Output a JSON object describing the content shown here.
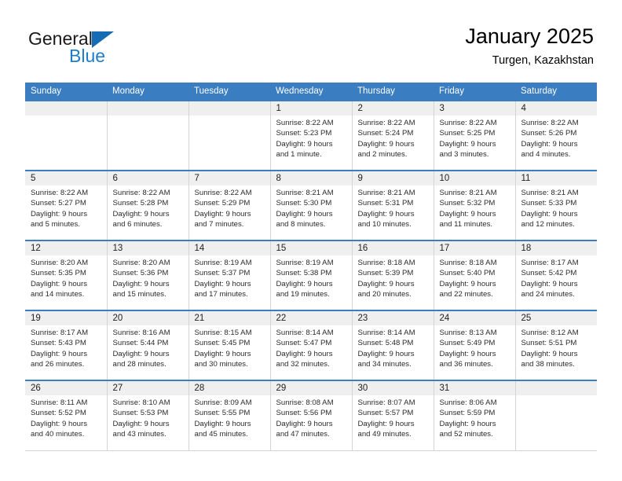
{
  "brand": {
    "name_top": "General",
    "name_bottom": "Blue",
    "triangle_color": "#156cb4",
    "blue_color": "#1f7cc6"
  },
  "header": {
    "title": "January 2025",
    "subtitle": "Turgen, Kazakhstan"
  },
  "theme": {
    "header_bg": "#3a7dc0",
    "daynum_bg": "#efefef",
    "grid_border": "#d4d4d4",
    "row_top_border": "#3a7dc0"
  },
  "weekdays": [
    "Sunday",
    "Monday",
    "Tuesday",
    "Wednesday",
    "Thursday",
    "Friday",
    "Saturday"
  ],
  "weeks": [
    [
      {
        "day": "",
        "lines": []
      },
      {
        "day": "",
        "lines": []
      },
      {
        "day": "",
        "lines": []
      },
      {
        "day": "1",
        "lines": [
          "Sunrise: 8:22 AM",
          "Sunset: 5:23 PM",
          "Daylight: 9 hours",
          "and 1 minute."
        ]
      },
      {
        "day": "2",
        "lines": [
          "Sunrise: 8:22 AM",
          "Sunset: 5:24 PM",
          "Daylight: 9 hours",
          "and 2 minutes."
        ]
      },
      {
        "day": "3",
        "lines": [
          "Sunrise: 8:22 AM",
          "Sunset: 5:25 PM",
          "Daylight: 9 hours",
          "and 3 minutes."
        ]
      },
      {
        "day": "4",
        "lines": [
          "Sunrise: 8:22 AM",
          "Sunset: 5:26 PM",
          "Daylight: 9 hours",
          "and 4 minutes."
        ]
      }
    ],
    [
      {
        "day": "5",
        "lines": [
          "Sunrise: 8:22 AM",
          "Sunset: 5:27 PM",
          "Daylight: 9 hours",
          "and 5 minutes."
        ]
      },
      {
        "day": "6",
        "lines": [
          "Sunrise: 8:22 AM",
          "Sunset: 5:28 PM",
          "Daylight: 9 hours",
          "and 6 minutes."
        ]
      },
      {
        "day": "7",
        "lines": [
          "Sunrise: 8:22 AM",
          "Sunset: 5:29 PM",
          "Daylight: 9 hours",
          "and 7 minutes."
        ]
      },
      {
        "day": "8",
        "lines": [
          "Sunrise: 8:21 AM",
          "Sunset: 5:30 PM",
          "Daylight: 9 hours",
          "and 8 minutes."
        ]
      },
      {
        "day": "9",
        "lines": [
          "Sunrise: 8:21 AM",
          "Sunset: 5:31 PM",
          "Daylight: 9 hours",
          "and 10 minutes."
        ]
      },
      {
        "day": "10",
        "lines": [
          "Sunrise: 8:21 AM",
          "Sunset: 5:32 PM",
          "Daylight: 9 hours",
          "and 11 minutes."
        ]
      },
      {
        "day": "11",
        "lines": [
          "Sunrise: 8:21 AM",
          "Sunset: 5:33 PM",
          "Daylight: 9 hours",
          "and 12 minutes."
        ]
      }
    ],
    [
      {
        "day": "12",
        "lines": [
          "Sunrise: 8:20 AM",
          "Sunset: 5:35 PM",
          "Daylight: 9 hours",
          "and 14 minutes."
        ]
      },
      {
        "day": "13",
        "lines": [
          "Sunrise: 8:20 AM",
          "Sunset: 5:36 PM",
          "Daylight: 9 hours",
          "and 15 minutes."
        ]
      },
      {
        "day": "14",
        "lines": [
          "Sunrise: 8:19 AM",
          "Sunset: 5:37 PM",
          "Daylight: 9 hours",
          "and 17 minutes."
        ]
      },
      {
        "day": "15",
        "lines": [
          "Sunrise: 8:19 AM",
          "Sunset: 5:38 PM",
          "Daylight: 9 hours",
          "and 19 minutes."
        ]
      },
      {
        "day": "16",
        "lines": [
          "Sunrise: 8:18 AM",
          "Sunset: 5:39 PM",
          "Daylight: 9 hours",
          "and 20 minutes."
        ]
      },
      {
        "day": "17",
        "lines": [
          "Sunrise: 8:18 AM",
          "Sunset: 5:40 PM",
          "Daylight: 9 hours",
          "and 22 minutes."
        ]
      },
      {
        "day": "18",
        "lines": [
          "Sunrise: 8:17 AM",
          "Sunset: 5:42 PM",
          "Daylight: 9 hours",
          "and 24 minutes."
        ]
      }
    ],
    [
      {
        "day": "19",
        "lines": [
          "Sunrise: 8:17 AM",
          "Sunset: 5:43 PM",
          "Daylight: 9 hours",
          "and 26 minutes."
        ]
      },
      {
        "day": "20",
        "lines": [
          "Sunrise: 8:16 AM",
          "Sunset: 5:44 PM",
          "Daylight: 9 hours",
          "and 28 minutes."
        ]
      },
      {
        "day": "21",
        "lines": [
          "Sunrise: 8:15 AM",
          "Sunset: 5:45 PM",
          "Daylight: 9 hours",
          "and 30 minutes."
        ]
      },
      {
        "day": "22",
        "lines": [
          "Sunrise: 8:14 AM",
          "Sunset: 5:47 PM",
          "Daylight: 9 hours",
          "and 32 minutes."
        ]
      },
      {
        "day": "23",
        "lines": [
          "Sunrise: 8:14 AM",
          "Sunset: 5:48 PM",
          "Daylight: 9 hours",
          "and 34 minutes."
        ]
      },
      {
        "day": "24",
        "lines": [
          "Sunrise: 8:13 AM",
          "Sunset: 5:49 PM",
          "Daylight: 9 hours",
          "and 36 minutes."
        ]
      },
      {
        "day": "25",
        "lines": [
          "Sunrise: 8:12 AM",
          "Sunset: 5:51 PM",
          "Daylight: 9 hours",
          "and 38 minutes."
        ]
      }
    ],
    [
      {
        "day": "26",
        "lines": [
          "Sunrise: 8:11 AM",
          "Sunset: 5:52 PM",
          "Daylight: 9 hours",
          "and 40 minutes."
        ]
      },
      {
        "day": "27",
        "lines": [
          "Sunrise: 8:10 AM",
          "Sunset: 5:53 PM",
          "Daylight: 9 hours",
          "and 43 minutes."
        ]
      },
      {
        "day": "28",
        "lines": [
          "Sunrise: 8:09 AM",
          "Sunset: 5:55 PM",
          "Daylight: 9 hours",
          "and 45 minutes."
        ]
      },
      {
        "day": "29",
        "lines": [
          "Sunrise: 8:08 AM",
          "Sunset: 5:56 PM",
          "Daylight: 9 hours",
          "and 47 minutes."
        ]
      },
      {
        "day": "30",
        "lines": [
          "Sunrise: 8:07 AM",
          "Sunset: 5:57 PM",
          "Daylight: 9 hours",
          "and 49 minutes."
        ]
      },
      {
        "day": "31",
        "lines": [
          "Sunrise: 8:06 AM",
          "Sunset: 5:59 PM",
          "Daylight: 9 hours",
          "and 52 minutes."
        ]
      },
      {
        "day": "",
        "lines": []
      }
    ]
  ]
}
